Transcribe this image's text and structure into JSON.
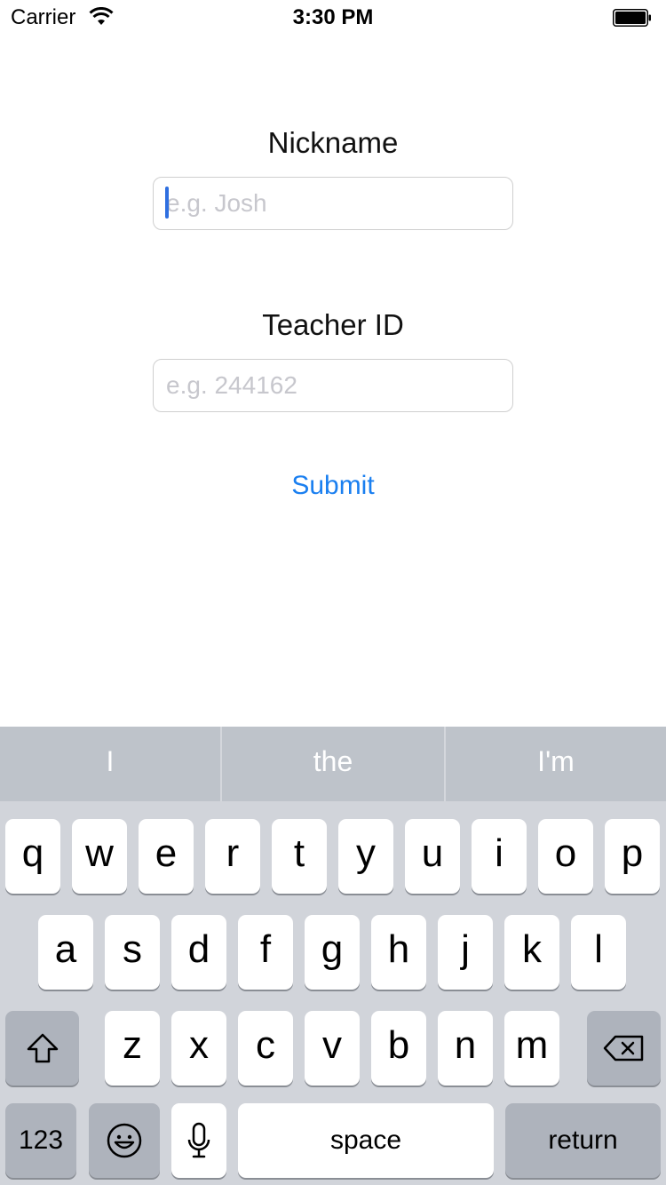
{
  "status_bar": {
    "carrier": "Carrier",
    "time": "3:30 PM",
    "wifi_icon": "wifi-icon",
    "battery_icon": "battery-icon"
  },
  "form": {
    "nickname_label": "Nickname",
    "nickname_placeholder": "e.g. Josh",
    "nickname_value": "",
    "teacher_id_label": "Teacher ID",
    "teacher_id_placeholder": "e.g. 244162",
    "teacher_id_value": "",
    "submit_label": "Submit",
    "accent_color": "#1a7ff0"
  },
  "keyboard": {
    "suggestions": [
      "I",
      "the",
      "I'm"
    ],
    "row1": [
      "q",
      "w",
      "e",
      "r",
      "t",
      "y",
      "u",
      "i",
      "o",
      "p"
    ],
    "row2": [
      "a",
      "s",
      "d",
      "f",
      "g",
      "h",
      "j",
      "k",
      "l"
    ],
    "row3": [
      "z",
      "x",
      "c",
      "v",
      "b",
      "n",
      "m"
    ],
    "shift_icon": "shift-icon",
    "delete_icon": "delete-icon",
    "numbers_label": "123",
    "emoji_icon": "emoji-icon",
    "mic_icon": "microphone-icon",
    "space_label": "space",
    "return_label": "return"
  }
}
